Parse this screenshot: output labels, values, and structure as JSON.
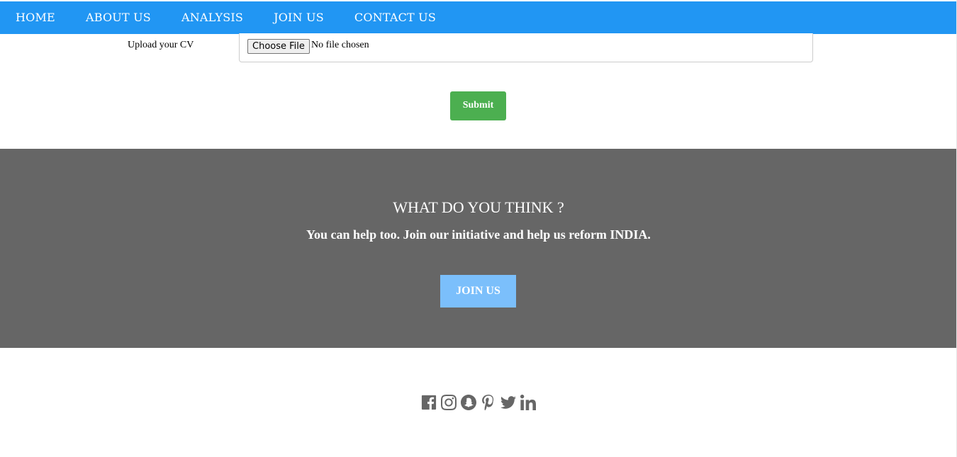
{
  "nav": {
    "items": [
      {
        "label": "HOME"
      },
      {
        "label": "ABOUT US"
      },
      {
        "label": "ANALYSIS"
      },
      {
        "label": "JOIN US"
      },
      {
        "label": "CONTACT US"
      }
    ]
  },
  "form": {
    "upload_label": "Upload your CV",
    "choose_file_label": "Choose File",
    "file_status": "No file chosen",
    "submit_label": "Submit"
  },
  "cta": {
    "title": "WHAT DO YOU THINK ?",
    "text": "You can help too. Join our initiative and help us reform INDIA.",
    "button_label": "JOIN US"
  },
  "social": {
    "icons": [
      "facebook-icon",
      "instagram-icon",
      "snapchat-icon",
      "pinterest-icon",
      "twitter-icon",
      "linkedin-icon"
    ]
  },
  "colors": {
    "nav_bg": "#2196f3",
    "submit_bg": "#4caf50",
    "cta_bg": "#666666",
    "cta_button_bg": "#7bbffb",
    "icon_color": "#666666"
  }
}
